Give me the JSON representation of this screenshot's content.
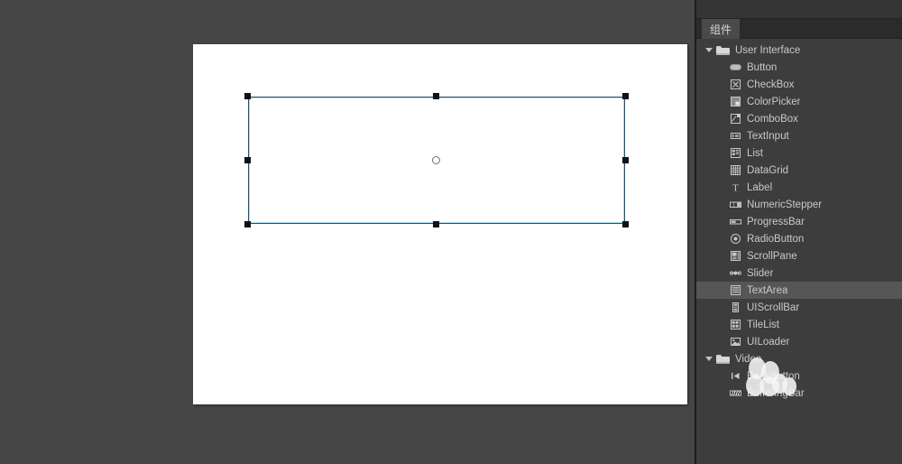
{
  "workspace": {
    "background_color": "#464646",
    "stage": {
      "background_color": "#ffffff",
      "selection": {
        "border_color": "#a9dbee",
        "handle_color": "#121212",
        "registration_point": "registration-point-circle",
        "handles": [
          "nw",
          "n",
          "ne",
          "w",
          "e",
          "sw",
          "s",
          "se"
        ]
      }
    }
  },
  "panel": {
    "title": "",
    "tab_label": "组件",
    "selected_item": "TextArea",
    "selected_row_color": "#565656",
    "background_color": "#3d3d3d",
    "tree": [
      {
        "label": "User Interface",
        "icon": "folder-icon",
        "expanded": true,
        "children": [
          {
            "label": "Button",
            "icon": "button-icon"
          },
          {
            "label": "CheckBox",
            "icon": "checkbox-icon"
          },
          {
            "label": "ColorPicker",
            "icon": "colorpicker-icon"
          },
          {
            "label": "ComboBox",
            "icon": "combobox-icon"
          },
          {
            "label": "TextInput",
            "icon": "textinput-icon"
          },
          {
            "label": "List",
            "icon": "list-icon"
          },
          {
            "label": "DataGrid",
            "icon": "datagrid-icon"
          },
          {
            "label": "Label",
            "icon": "label-icon"
          },
          {
            "label": "NumericStepper",
            "icon": "numericstepper-icon"
          },
          {
            "label": "ProgressBar",
            "icon": "progressbar-icon"
          },
          {
            "label": "RadioButton",
            "icon": "radiobutton-icon"
          },
          {
            "label": "ScrollPane",
            "icon": "scrollpane-icon"
          },
          {
            "label": "Slider",
            "icon": "slider-icon"
          },
          {
            "label": "TextArea",
            "icon": "textarea-icon",
            "selected": true
          },
          {
            "label": "UIScrollBar",
            "icon": "uiscrollbar-icon"
          },
          {
            "label": "TileList",
            "icon": "tilelist-icon"
          },
          {
            "label": "UILoader",
            "icon": "uiloader-icon"
          }
        ]
      },
      {
        "label": "Video",
        "icon": "folder-icon",
        "expanded": true,
        "children": [
          {
            "label": "BackButton",
            "icon": "backbutton-icon"
          },
          {
            "label": "BufferingBar",
            "icon": "bufferingbar-icon"
          }
        ]
      }
    ]
  }
}
